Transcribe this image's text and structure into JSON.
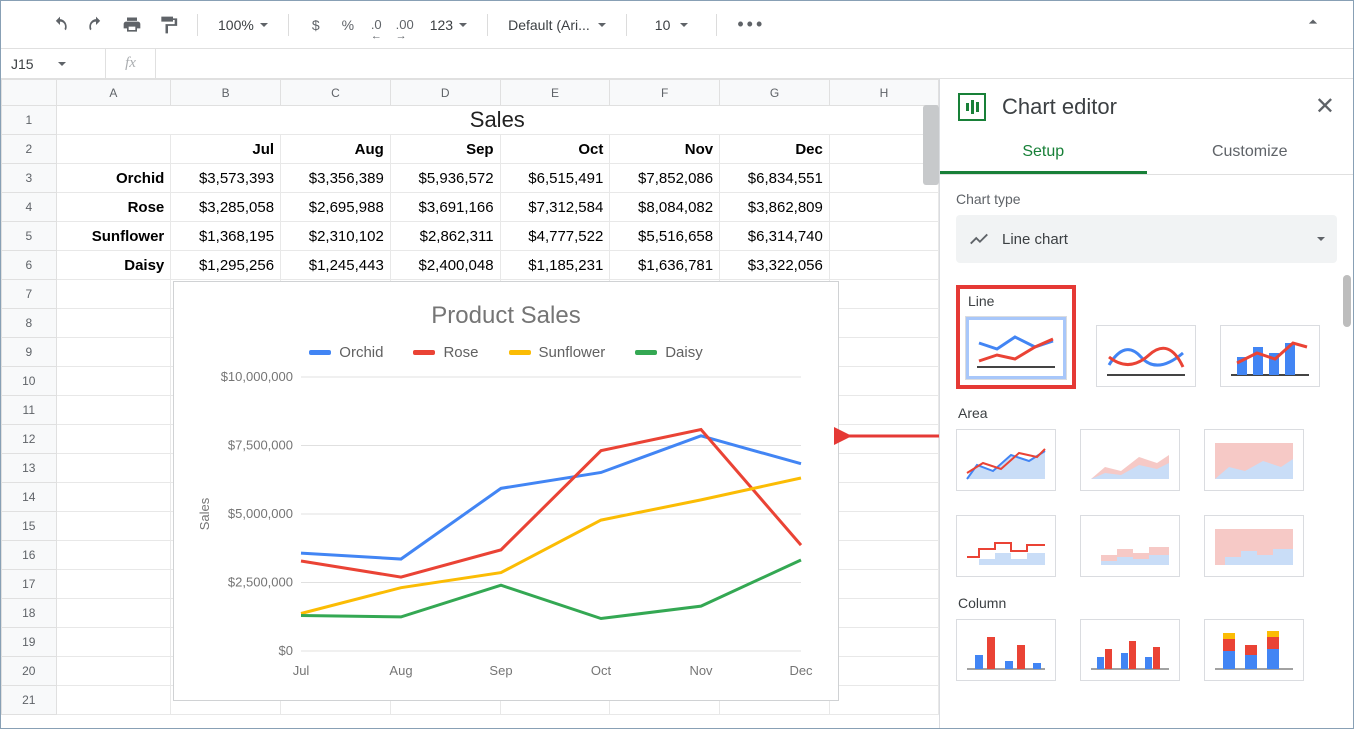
{
  "toolbar": {
    "zoom": "100%",
    "currency": "$",
    "percent": "%",
    "dec_less": ".0",
    "dec_more": ".00",
    "num_fmt": "123",
    "font": "Default (Ari...",
    "font_size": "10"
  },
  "name_box": {
    "cell_ref": "J15",
    "fx_label": "fx"
  },
  "grid": {
    "col_heads": [
      "A",
      "B",
      "C",
      "D",
      "E",
      "F",
      "G",
      "H"
    ],
    "row_heads": [
      "1",
      "2",
      "3",
      "4",
      "5",
      "6",
      "7",
      "8",
      "9",
      "10",
      "11",
      "12",
      "13",
      "14",
      "15",
      "16",
      "17",
      "18",
      "19",
      "20",
      "21"
    ],
    "title": "Sales",
    "months": [
      "Jul",
      "Aug",
      "Sep",
      "Oct",
      "Nov",
      "Dec"
    ],
    "rows": [
      {
        "name": "Orchid",
        "vals": [
          "$3,573,393",
          "$3,356,389",
          "$5,936,572",
          "$6,515,491",
          "$7,852,086",
          "$6,834,551"
        ]
      },
      {
        "name": "Rose",
        "vals": [
          "$3,285,058",
          "$2,695,988",
          "$3,691,166",
          "$7,312,584",
          "$8,084,082",
          "$3,862,809"
        ]
      },
      {
        "name": "Sunflower",
        "vals": [
          "$1,368,195",
          "$2,310,102",
          "$2,862,311",
          "$4,777,522",
          "$5,516,658",
          "$6,314,740"
        ]
      },
      {
        "name": "Daisy",
        "vals": [
          "$1,295,256",
          "$1,245,443",
          "$2,400,048",
          "$1,185,231",
          "$1,636,781",
          "$3,322,056"
        ]
      }
    ]
  },
  "chart_data": {
    "type": "line",
    "title": "Product Sales",
    "xlabel": "",
    "ylabel": "Sales",
    "categories": [
      "Jul",
      "Aug",
      "Sep",
      "Oct",
      "Nov",
      "Dec"
    ],
    "series": [
      {
        "name": "Orchid",
        "color": "#4285f4",
        "values": [
          3573393,
          3356389,
          5936572,
          6515491,
          7852086,
          6834551
        ]
      },
      {
        "name": "Rose",
        "color": "#ea4335",
        "values": [
          3285058,
          2695988,
          3691166,
          7312584,
          8084082,
          3862809
        ]
      },
      {
        "name": "Sunflower",
        "color": "#fbbc04",
        "values": [
          1368195,
          2310102,
          2862311,
          4777522,
          5516658,
          6314740
        ]
      },
      {
        "name": "Daisy",
        "color": "#34a853",
        "values": [
          1295256,
          1245443,
          2400048,
          1185231,
          1636781,
          3322056
        ]
      }
    ],
    "ylim": [
      0,
      10000000
    ],
    "yticks": [
      "$0",
      "$2,500,000",
      "$5,000,000",
      "$7,500,000",
      "$10,000,000"
    ]
  },
  "editor": {
    "title": "Chart editor",
    "tab_setup": "Setup",
    "tab_customize": "Customize",
    "chart_type_label": "Chart type",
    "chart_type_value": "Line chart",
    "cat_line": "Line",
    "cat_area": "Area",
    "cat_column": "Column"
  }
}
